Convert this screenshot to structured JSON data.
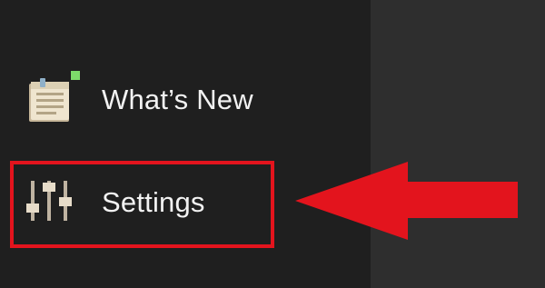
{
  "sidebar": {
    "items": [
      {
        "label": "What’s New",
        "icon": "notepad-icon"
      },
      {
        "label": "Settings",
        "icon": "sliders-icon"
      }
    ]
  },
  "annotation": {
    "highlight_color": "#e3141d",
    "target": "Settings"
  },
  "colors": {
    "sidebar_bg": "#1f1f1f",
    "content_bg": "#2e2e2e",
    "text": "#f2f2f2",
    "accent_green": "#7ddc6a"
  }
}
